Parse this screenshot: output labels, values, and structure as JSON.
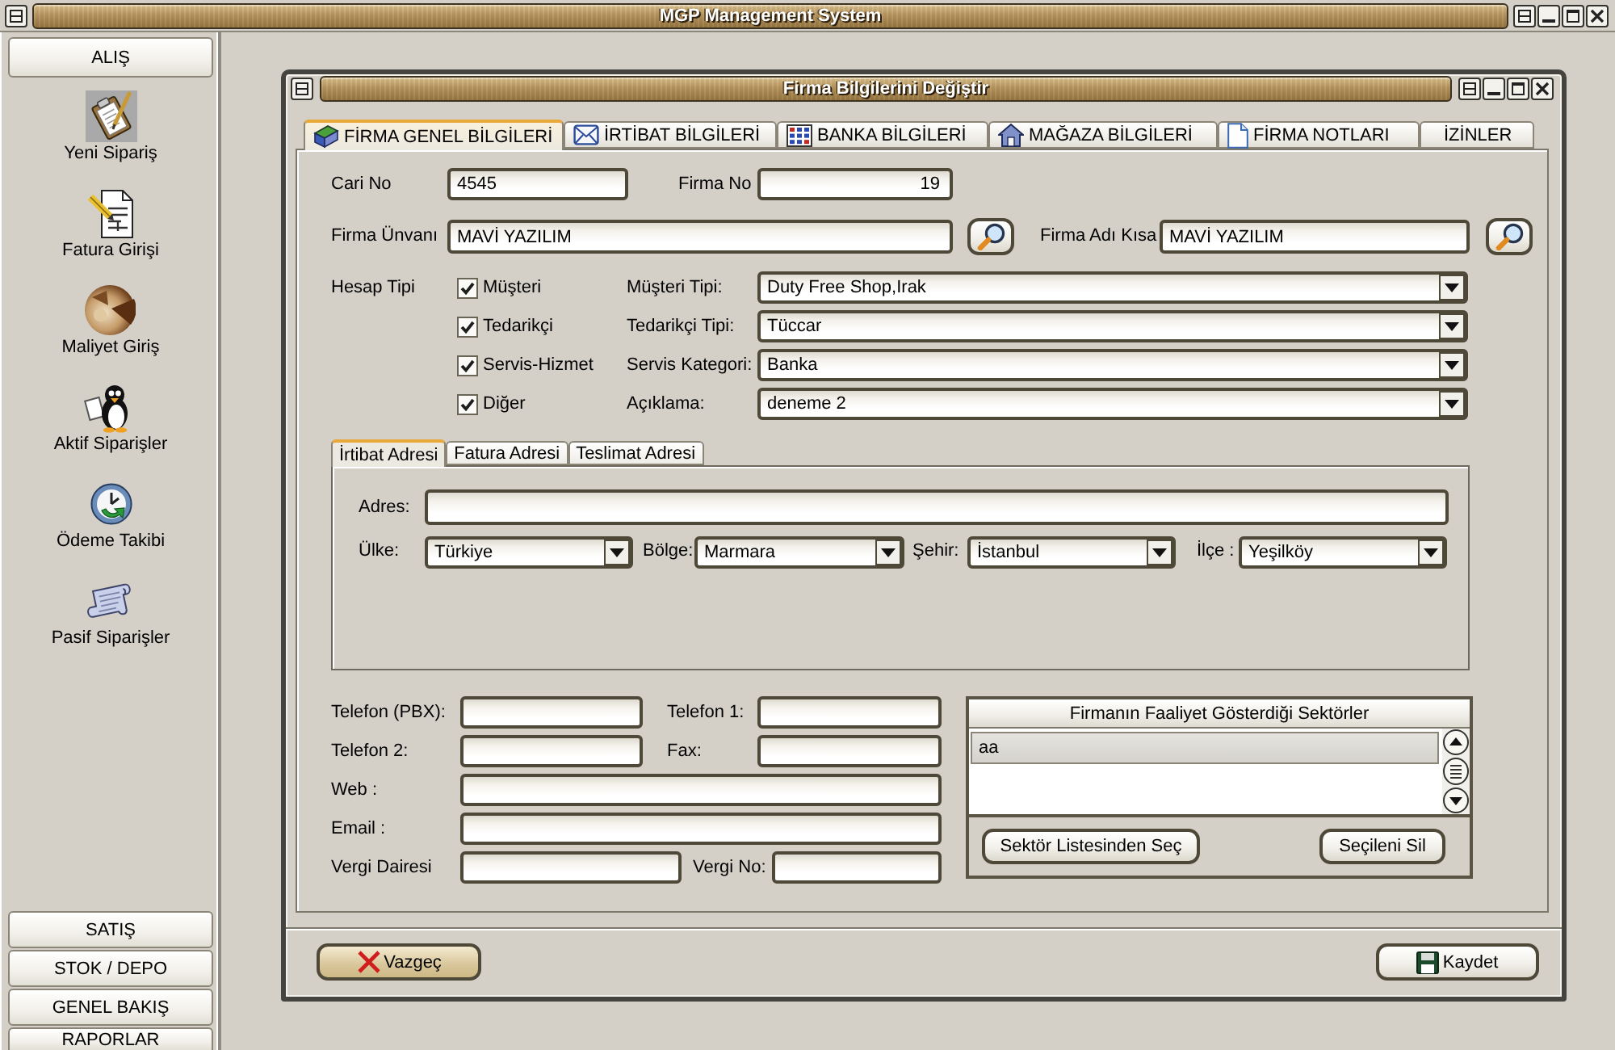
{
  "app_window": {
    "title": "MGP Management System"
  },
  "sidebar": {
    "group": {
      "label": "ALIŞ"
    },
    "items": [
      {
        "label": "Yeni Sipariş",
        "selected": true
      },
      {
        "label": "Fatura Girişi",
        "selected": false
      },
      {
        "label": "Maliyet Giriş",
        "selected": false
      },
      {
        "label": "Aktif Siparişler",
        "selected": false
      },
      {
        "label": "Ödeme Takibi",
        "selected": false
      },
      {
        "label": "Pasif Siparişler",
        "selected": false
      }
    ],
    "sections": [
      {
        "label": "SATIŞ"
      },
      {
        "label": "STOK / DEPO"
      },
      {
        "label": "GENEL BAKIŞ"
      },
      {
        "label": "RAPORLAR"
      }
    ]
  },
  "dialog": {
    "title": "Firma Bilgilerini Değiştir",
    "tabs": [
      {
        "label": "FİRMA GENEL BİLGİLERİ",
        "selected": true
      },
      {
        "label": "İRTİBAT BİLGİLERİ",
        "selected": false
      },
      {
        "label": "BANKA BİLGİLERİ",
        "selected": false
      },
      {
        "label": "MAĞAZA BİLGİLERİ",
        "selected": false
      },
      {
        "label": "FİRMA NOTLARI",
        "selected": false
      },
      {
        "label": "İZİNLER",
        "selected": false
      }
    ],
    "cari_no": {
      "label": "Cari No",
      "value": "4545"
    },
    "firma_no": {
      "label": "Firma No",
      "value": "19"
    },
    "firma_unvani": {
      "label": "Firma Ünvanı",
      "value": "MAVİ YAZILIM"
    },
    "firma_adi_kisa": {
      "label": "Firma Adı Kısa",
      "value": "MAVİ YAZILIM"
    },
    "hesap_tipi": {
      "label": "Hesap Tipi",
      "options": [
        {
          "label": "Müşteri",
          "checked": true
        },
        {
          "label": "Tedarikçi",
          "checked": true
        },
        {
          "label": "Servis-Hizmet",
          "checked": true
        },
        {
          "label": "Diğer",
          "checked": true
        }
      ]
    },
    "types": [
      {
        "label": "Müşteri Tipi:",
        "value": "Duty Free Shop,Irak"
      },
      {
        "label": "Tedarikçi Tipi:",
        "value": "Tüccar"
      },
      {
        "label": "Servis Kategori:",
        "value": "Banka"
      },
      {
        "label": "Açıklama:",
        "value": "deneme 2"
      }
    ],
    "address": {
      "tabs": [
        {
          "label": "İrtibat Adresi",
          "selected": true
        },
        {
          "label": "Fatura Adresi",
          "selected": false
        },
        {
          "label": "Teslimat Adresi",
          "selected": false
        }
      ],
      "adres": {
        "label": "Adres:"
      },
      "location": [
        {
          "label": "Ülke:",
          "value": "Türkiye"
        },
        {
          "label": "Bölge:",
          "value": "Marmara"
        },
        {
          "label": "Şehir:",
          "value": "İstanbul"
        },
        {
          "label": "İlçe :",
          "value": "Yeşilköy"
        }
      ]
    },
    "contact": {
      "telefon_pbx": {
        "label": "Telefon (PBX):"
      },
      "telefon_1": {
        "label": "Telefon 1:"
      },
      "telefon_2": {
        "label": "Telefon 2:"
      },
      "fax": {
        "label": "Fax:"
      },
      "web": {
        "label": "Web :"
      },
      "email": {
        "label": "Email :"
      },
      "vergi_dairesi": {
        "label": "Vergi Dairesi"
      },
      "vergi_no": {
        "label": "Vergi No:"
      }
    },
    "sectors": {
      "title": "Firmanın Faaliyet Gösterdiği Sektörler",
      "items": [
        {
          "label": "aa",
          "selected": true
        }
      ],
      "buttons": [
        {
          "label": "Sektör Listesinden Seç"
        },
        {
          "label": "Seçileni Sil"
        }
      ]
    },
    "buttons": [
      {
        "kind": "cancel",
        "label": "Vazgeç",
        "focused": true
      },
      {
        "kind": "save",
        "label": "Kaydet",
        "focused": false
      }
    ]
  }
}
